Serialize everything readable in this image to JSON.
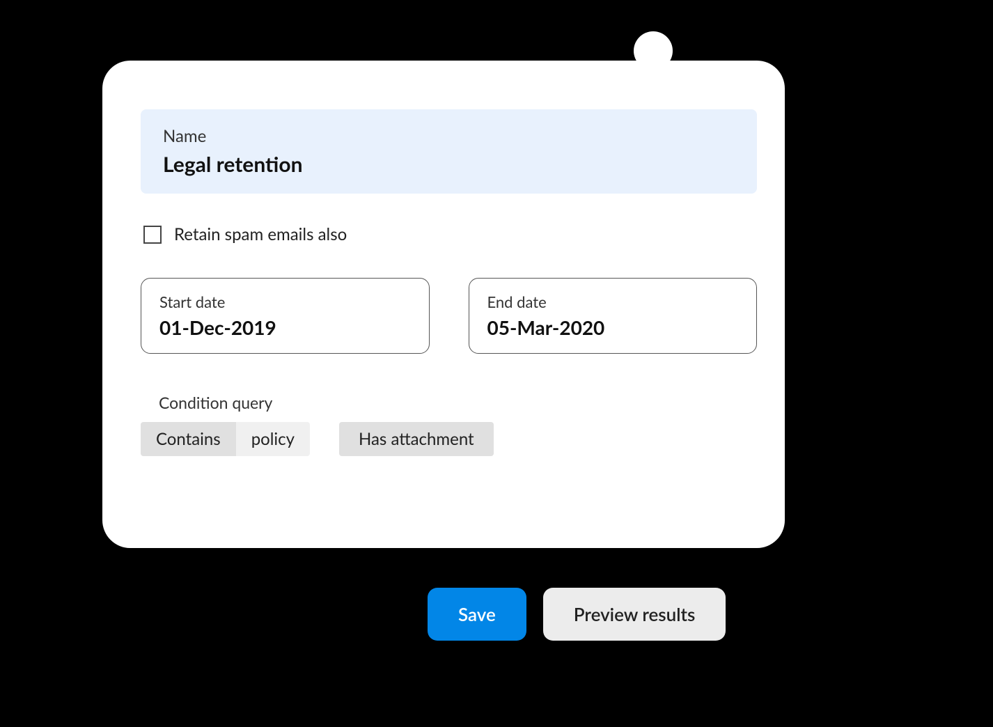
{
  "card": {
    "name_label": "Name",
    "name_value": "Legal retention",
    "retain_spam_label": "Retain spam emails also",
    "retain_spam_checked": false,
    "start_date_label": "Start date",
    "start_date_value": "01-Dec-2019",
    "end_date_label": "End date",
    "end_date_value": "05-Mar-2020",
    "condition_label": "Condition query",
    "conditions": {
      "chip1_operator": "Contains",
      "chip1_value": "policy",
      "chip2": "Has attachment"
    }
  },
  "buttons": {
    "save": "Save",
    "preview": "Preview results"
  }
}
